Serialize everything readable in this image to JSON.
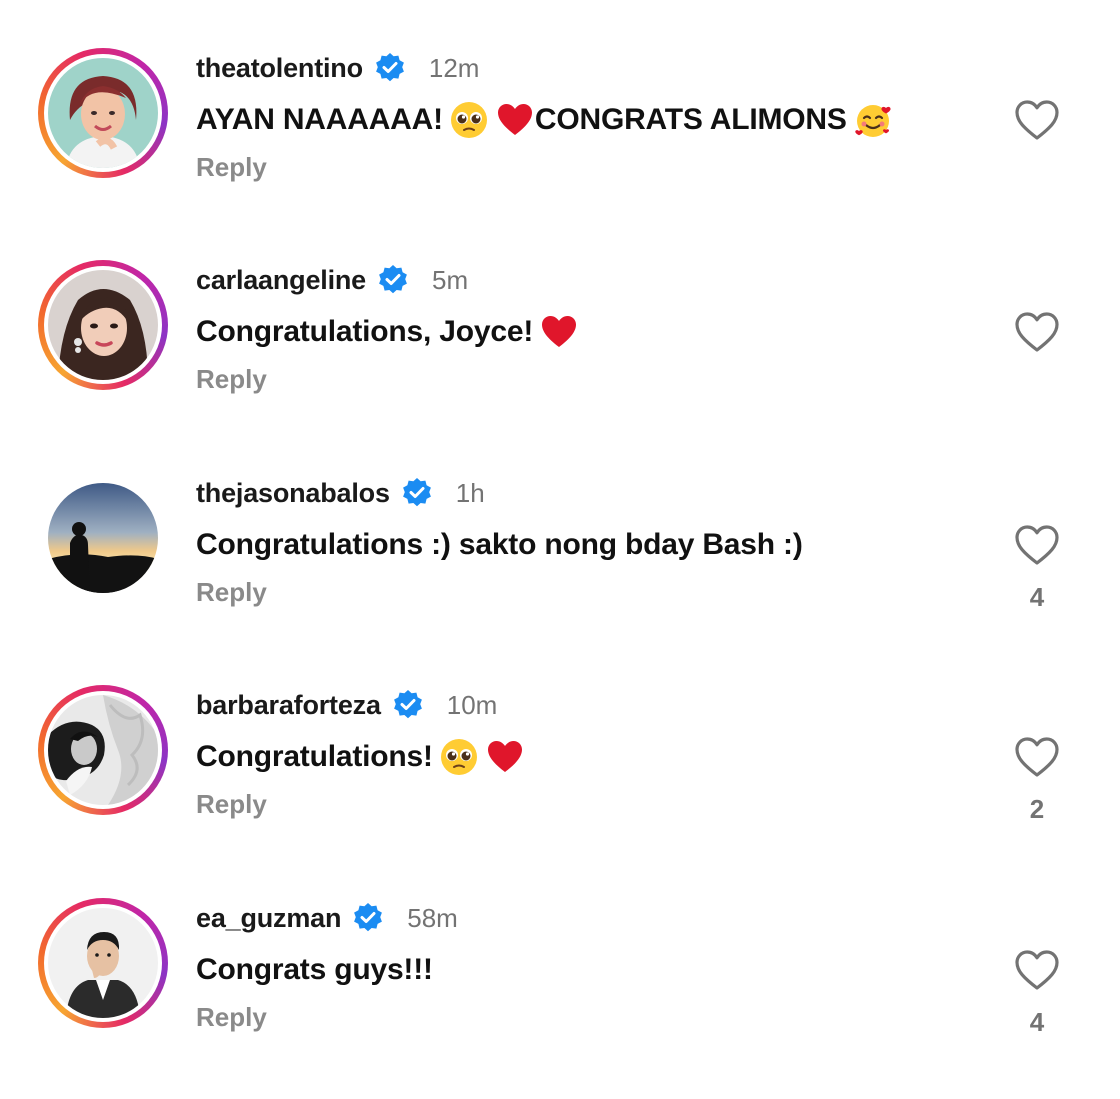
{
  "comments": [
    {
      "username": "theatolentino",
      "verified": true,
      "time": "12m",
      "text_parts": [
        "AYAN NAAAAAA! ",
        " CONGRATS ALIMONS"
      ],
      "emojis": [
        "pleading-face",
        "red-heart",
        "smiling-face-with-hearts"
      ],
      "reply_label": "Reply",
      "like_count": "",
      "story_ring": true
    },
    {
      "username": "carlaangeline",
      "verified": true,
      "time": "5m",
      "text_parts": [
        "Congratulations, Joyce! "
      ],
      "emojis": [
        "red-heart"
      ],
      "reply_label": "Reply",
      "like_count": "",
      "story_ring": true
    },
    {
      "username": "thejasonabalos",
      "verified": true,
      "time": "1h",
      "text_parts": [
        "Congratulations :) sakto nong bday Bash :)"
      ],
      "emojis": [],
      "reply_label": "Reply",
      "like_count": "4",
      "story_ring": false
    },
    {
      "username": "barbaraforteza",
      "verified": true,
      "time": "10m",
      "text_parts": [
        "Congratulations! "
      ],
      "emojis": [
        "pleading-face",
        "red-heart"
      ],
      "reply_label": "Reply",
      "like_count": "2",
      "story_ring": true
    },
    {
      "username": "ea_guzman",
      "verified": true,
      "time": "58m",
      "text_parts": [
        "Congrats guys!!!"
      ],
      "emojis": [],
      "reply_label": "Reply",
      "like_count": "4",
      "story_ring": true
    }
  ],
  "colors": {
    "verified_blue": "#1b8cf2",
    "meta_gray": "#737373",
    "reply_gray": "#8a8a8a",
    "heart_red": "#e0162b"
  },
  "icons": {
    "verified": "verified-badge-icon",
    "like": "heart-outline-icon"
  }
}
